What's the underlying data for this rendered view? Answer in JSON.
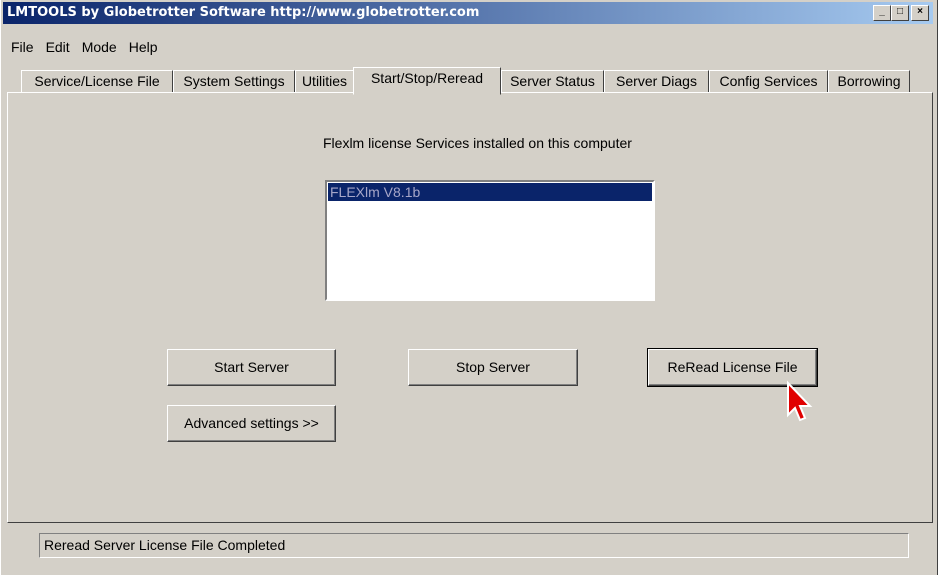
{
  "window": {
    "title": "LMTOOLS by Globetrotter Software http://www.globetrotter.com"
  },
  "title_buttons": {
    "minimize": "_",
    "maximize": "□",
    "close": "×"
  },
  "menu": [
    "File",
    "Edit",
    "Mode",
    "Help"
  ],
  "tabs": [
    "Service/License File",
    "System Settings",
    "Utilities",
    "Start/Stop/Reread",
    "Server Status",
    "Server Diags",
    "Config Services",
    "Borrowing"
  ],
  "active_tab": "Start/Stop/Reread",
  "main": {
    "services_heading": "Flexlm license Services installed on this computer",
    "services": [
      "FLEXlm V8.1b"
    ],
    "selected_service": "FLEXlm V8.1b",
    "start_button": "Start Server",
    "stop_button": "Stop Server",
    "reread_button": "ReRead License File",
    "advanced_button": "Advanced settings >>"
  },
  "status": {
    "text": "Reread Server License File Completed"
  },
  "icons": {
    "cursor": "arrow-cursor-icon"
  },
  "colors": {
    "titlebar": "#0a246a",
    "selection": "#0a246a",
    "cursor": "#e00000"
  }
}
